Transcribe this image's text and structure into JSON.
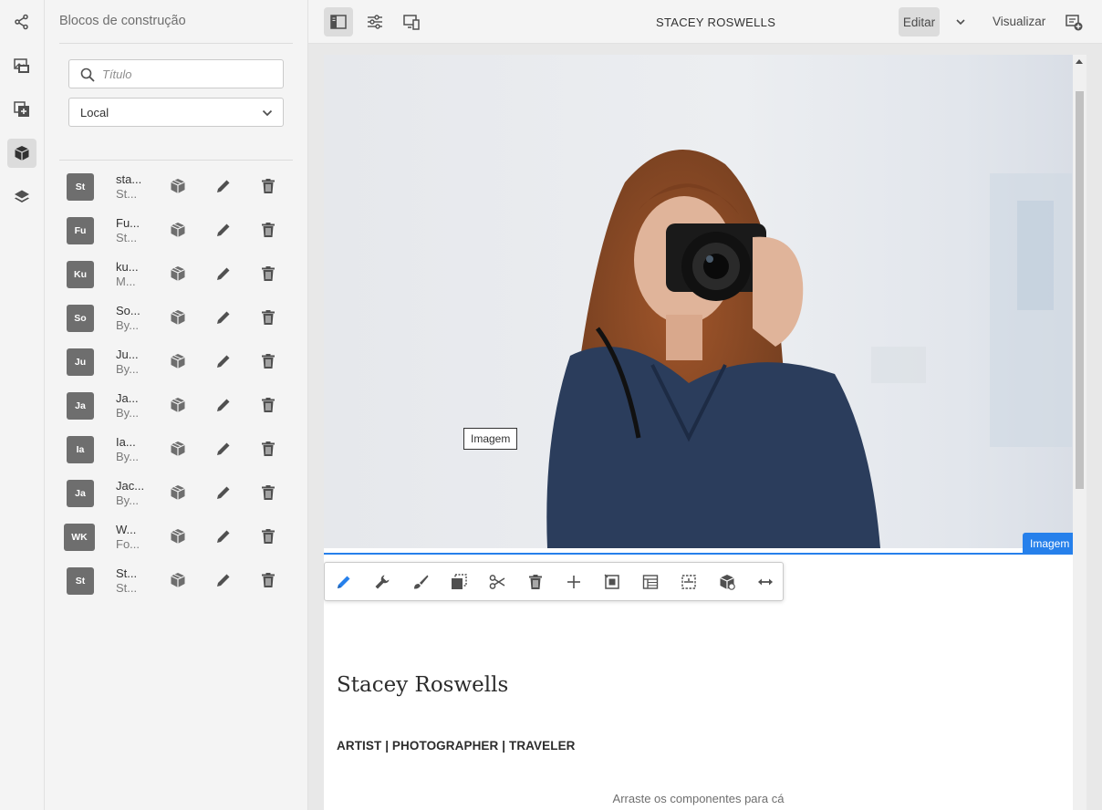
{
  "side_panel": {
    "title": "Blocos de construção",
    "search_placeholder": "Título",
    "filter_value": "Local",
    "items": [
      {
        "avatar": "St",
        "name": "sta...",
        "sub": "St..."
      },
      {
        "avatar": "Fu",
        "name": "Fu...",
        "sub": "St..."
      },
      {
        "avatar": "Ku",
        "name": "ku...",
        "sub": "M..."
      },
      {
        "avatar": "So",
        "name": "So...",
        "sub": "By..."
      },
      {
        "avatar": "Ju",
        "name": "Ju...",
        "sub": "By..."
      },
      {
        "avatar": "Ja",
        "name": "Ja...",
        "sub": "By..."
      },
      {
        "avatar": "Ia",
        "name": "Ia...",
        "sub": "By..."
      },
      {
        "avatar": "Ja",
        "name": "Jac...",
        "sub": "By..."
      },
      {
        "avatar": "WK",
        "name": "W...",
        "sub": "Fo..."
      },
      {
        "avatar": "St",
        "name": "St...",
        "sub": "St..."
      }
    ]
  },
  "topbar": {
    "page_name": "STACEY ROSWELLS",
    "edit_label": "Editar",
    "preview_label": "Visualizar"
  },
  "canvas": {
    "component_label": "Imagem",
    "tooltip": "Imagem",
    "title": "Stacey Roswells",
    "subtitle": "ARTIST | PHOTOGRAPHER | TRAVELER",
    "dropzone": "Arraste os componentes para cá"
  },
  "colors": {
    "accent": "#2680eb",
    "avatar_bg": "#6e6e6e",
    "panel_bg": "#f4f4f4"
  }
}
